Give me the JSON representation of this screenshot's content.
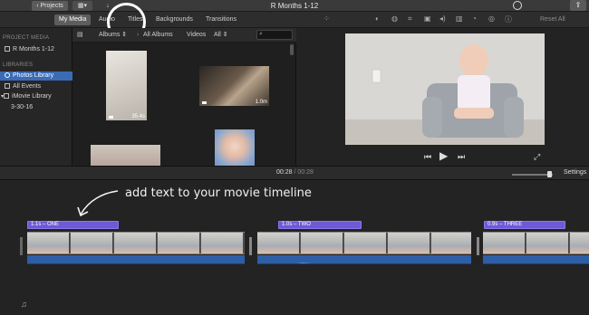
{
  "titlebar": {
    "projects_label": "Projects",
    "app_title": "R Months 1-12"
  },
  "tabs": {
    "my_media": "My Media",
    "audio": "Audio",
    "titles": "Titles",
    "backgrounds": "Backgrounds",
    "transitions": "Transitions"
  },
  "toolbar": {
    "reset_all": "Reset All"
  },
  "sidebar": {
    "project_media_header": "PROJECT MEDIA",
    "project_item": "R Months 1-12",
    "libraries_header": "LIBRARIES",
    "items": [
      {
        "label": "Photos Library"
      },
      {
        "label": "All Events"
      },
      {
        "label": "iMovie Library"
      },
      {
        "label": "3-30-16"
      }
    ]
  },
  "browser": {
    "albums_label": "Albums",
    "all_albums_label": "All Albums",
    "videos_label": "Videos",
    "all_label": "All",
    "clips": [
      {
        "duration": "35.4s"
      },
      {
        "duration": "1.0m"
      }
    ]
  },
  "timebar": {
    "current": "00:28",
    "separator": "/",
    "total": "00:28",
    "settings": "Settings"
  },
  "timeline": {
    "annotation": "add text to your movie timeline",
    "titles": [
      {
        "label": "1.1s – ONE"
      },
      {
        "label": "1.0s – TWO"
      },
      {
        "label": "0.9s – THREE"
      }
    ]
  },
  "colors": {
    "accent_blue": "#3b6bb5",
    "title_purple": "#6e5ad6",
    "audio_blue": "#2e5fa6"
  }
}
